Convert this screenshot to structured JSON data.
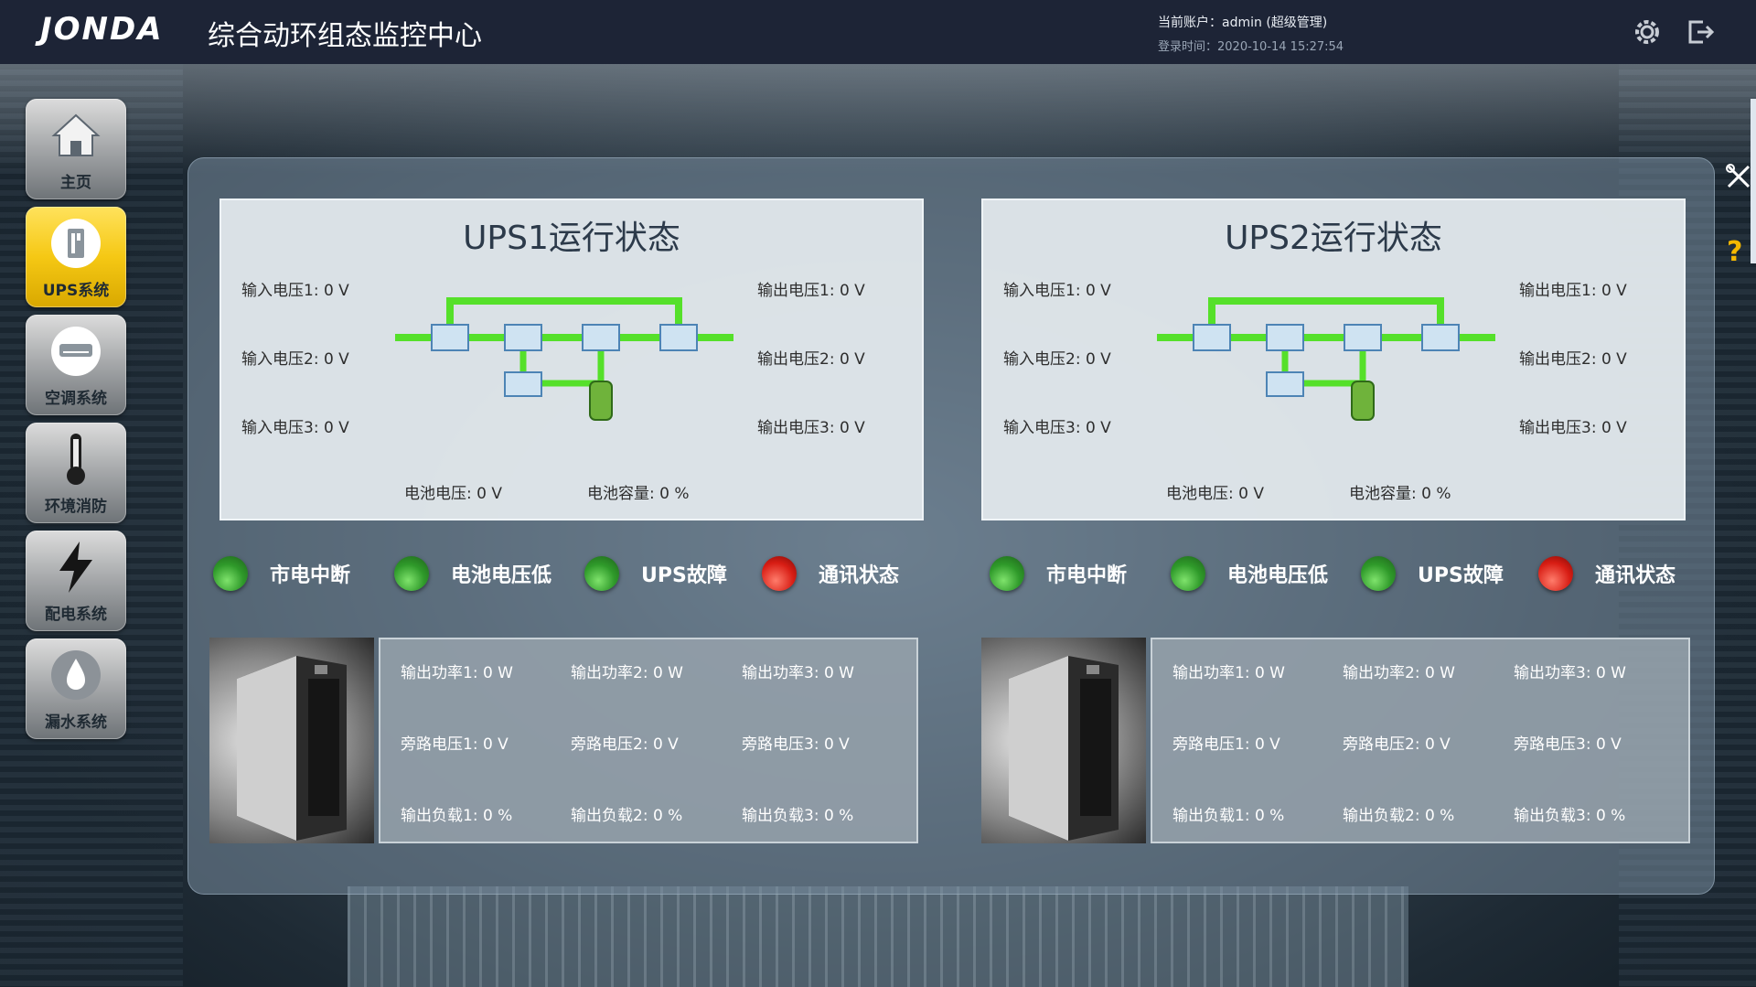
{
  "header": {
    "logo_text": "JONDA",
    "title": "综合动环组态监控中心",
    "account": "当前账户：admin (超级管理)",
    "login_time": "登录时间：2020-10-14 15:27:54",
    "icons": [
      "gear-icon",
      "logout-icon"
    ]
  },
  "sidebar": {
    "active": "UPS系统",
    "items": [
      {
        "label": "主页",
        "icon": "home-icon"
      },
      {
        "label": "UPS系统",
        "icon": "ups-icon"
      },
      {
        "label": "空调系统",
        "icon": "aircon-icon"
      },
      {
        "label": "环境消防",
        "icon": "thermometer-icon"
      },
      {
        "label": "配电系统",
        "icon": "lightning-icon"
      },
      {
        "label": "漏水系统",
        "icon": "water-drop-icon"
      }
    ]
  },
  "tools": {
    "icons": [
      "tools-icon",
      "help-icon"
    ],
    "help_text": "?"
  },
  "colors": {
    "active_yellow": "#f5c814",
    "led_green": "#2f9a2a",
    "led_red": "#d81d14",
    "flow_green": "#55e02a"
  },
  "ups": [
    {
      "title": "UPS1运行状态",
      "inputs": [
        "输入电压1: 0 V",
        "输入电压2: 0 V",
        "输入电压3: 0 V"
      ],
      "outputs": [
        "输出电压1: 0 V",
        "输出电压2: 0 V",
        "输出电压3: 0 V"
      ],
      "battery_voltage": "电池电压: 0 V",
      "battery_capacity": "电池容量: 0 %",
      "statuses": [
        {
          "label": "市电中断",
          "state": "green"
        },
        {
          "label": "电池电压低",
          "state": "green"
        },
        {
          "label": "UPS故障",
          "state": "green"
        },
        {
          "label": "通讯状态",
          "state": "red"
        }
      ],
      "metrics": [
        "输出功率1: 0 W",
        "输出功率2: 0 W",
        "输出功率3: 0 W",
        "旁路电压1: 0 V",
        "旁路电压2: 0 V",
        "旁路电压3: 0 V",
        "输出负载1: 0 %",
        "输出负载2: 0 %",
        "输出负载3: 0 %"
      ]
    },
    {
      "title": "UPS2运行状态",
      "inputs": [
        "输入电压1: 0 V",
        "输入电压2: 0 V",
        "输入电压3: 0 V"
      ],
      "outputs": [
        "输出电压1: 0 V",
        "输出电压2: 0 V",
        "输出电压3: 0 V"
      ],
      "battery_voltage": "电池电压: 0 V",
      "battery_capacity": "电池容量: 0 %",
      "statuses": [
        {
          "label": "市电中断",
          "state": "green"
        },
        {
          "label": "电池电压低",
          "state": "green"
        },
        {
          "label": "UPS故障",
          "state": "green"
        },
        {
          "label": "通讯状态",
          "state": "red"
        }
      ],
      "metrics": [
        "输出功率1: 0 W",
        "输出功率2: 0 W",
        "输出功率3: 0 W",
        "旁路电压1: 0 V",
        "旁路电压2: 0 V",
        "旁路电压3: 0 V",
        "输出负载1: 0 %",
        "输出负载2: 0 %",
        "输出负载3: 0 %"
      ]
    }
  ]
}
